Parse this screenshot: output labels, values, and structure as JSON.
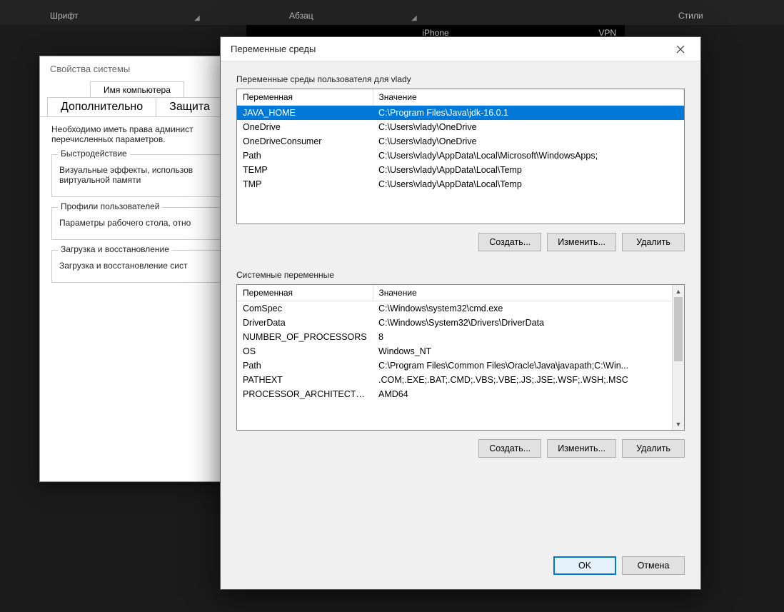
{
  "ribbon": {
    "font_group": "Шрифт",
    "paragraph_group": "Абзац",
    "styles_group": "Стили"
  },
  "phonebar": {
    "left": "",
    "mid": "iPhone",
    "right": "VPN"
  },
  "sysprops": {
    "title": "Свойства системы",
    "tabs": {
      "computer_name": "Имя компьютера",
      "advanced": "Дополнительно",
      "protection": "Защита"
    },
    "admin_note1": "Необходимо иметь права админист",
    "admin_note2": "перечисленных параметров.",
    "perf": {
      "legend": "Быстродействие",
      "text1": "Визуальные эффекты, использов",
      "text2": "виртуальной памяти"
    },
    "profiles": {
      "legend": "Профили пользователей",
      "text": "Параметры рабочего стола, отно"
    },
    "startup": {
      "legend": "Загрузка и восстановление",
      "text": "Загрузка и восстановление сист"
    }
  },
  "env": {
    "title": "Переменные среды",
    "user_section": "Переменные среды пользователя для vlady",
    "sys_section": "Системные переменные",
    "col_var": "Переменная",
    "col_val": "Значение",
    "user_vars": [
      {
        "name": "JAVA_HOME",
        "value": "C:\\Program Files\\Java\\jdk-16.0.1",
        "selected": true
      },
      {
        "name": "OneDrive",
        "value": "C:\\Users\\vlady\\OneDrive"
      },
      {
        "name": "OneDriveConsumer",
        "value": "C:\\Users\\vlady\\OneDrive"
      },
      {
        "name": "Path",
        "value": "C:\\Users\\vlady\\AppData\\Local\\Microsoft\\WindowsApps;"
      },
      {
        "name": "TEMP",
        "value": "C:\\Users\\vlady\\AppData\\Local\\Temp"
      },
      {
        "name": "TMP",
        "value": "C:\\Users\\vlady\\AppData\\Local\\Temp"
      }
    ],
    "sys_vars": [
      {
        "name": "ComSpec",
        "value": "C:\\Windows\\system32\\cmd.exe"
      },
      {
        "name": "DriverData",
        "value": "C:\\Windows\\System32\\Drivers\\DriverData"
      },
      {
        "name": "NUMBER_OF_PROCESSORS",
        "value": "8"
      },
      {
        "name": "OS",
        "value": "Windows_NT"
      },
      {
        "name": "Path",
        "value": "C:\\Program Files\\Common Files\\Oracle\\Java\\javapath;C:\\Win..."
      },
      {
        "name": "PATHEXT",
        "value": ".COM;.EXE;.BAT;.CMD;.VBS;.VBE;.JS;.JSE;.WSF;.WSH;.MSC"
      },
      {
        "name": "PROCESSOR_ARCHITECTU...",
        "value": "AMD64"
      }
    ],
    "buttons": {
      "new": "Создать...",
      "edit": "Изменить...",
      "delete": "Удалить",
      "ok": "OK",
      "cancel": "Отмена"
    }
  }
}
